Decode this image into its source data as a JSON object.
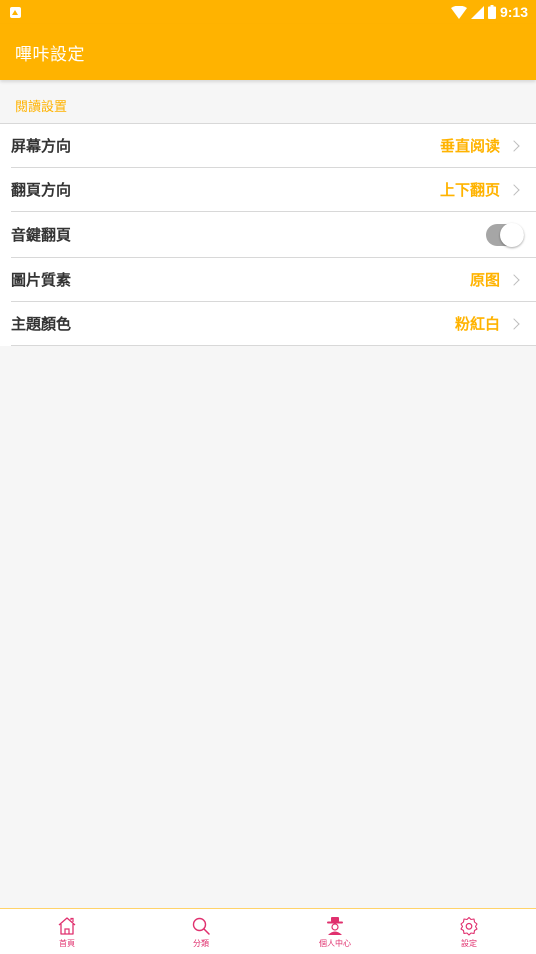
{
  "status_bar": {
    "time": "9:13",
    "icons": [
      "notification-icon",
      "wifi-icon",
      "signal-icon",
      "battery-icon"
    ]
  },
  "app_bar": {
    "title": "嗶咔設定"
  },
  "section": {
    "title": "閱讀設置"
  },
  "settings": [
    {
      "label": "屏幕方向",
      "value": "垂直阅读",
      "type": "chevron"
    },
    {
      "label": "翻頁方向",
      "value": "上下翻页",
      "type": "chevron"
    },
    {
      "label": "音鍵翻頁",
      "value": "",
      "type": "toggle",
      "enabled": true
    },
    {
      "label": "圖片質素",
      "value": "原图",
      "type": "chevron"
    },
    {
      "label": "主題顏色",
      "value": "粉紅白",
      "type": "chevron"
    }
  ],
  "bottom_nav": {
    "items": [
      {
        "label": "首頁",
        "icon": "home-icon"
      },
      {
        "label": "分類",
        "icon": "search-icon"
      },
      {
        "label": "個人中心",
        "icon": "profile-icon"
      },
      {
        "label": "設定",
        "icon": "gear-icon"
      }
    ]
  },
  "colors": {
    "accent": "#ffb300",
    "nav_accent": "#e0306e",
    "text": "#333333",
    "divider": "#d8d8d8"
  }
}
